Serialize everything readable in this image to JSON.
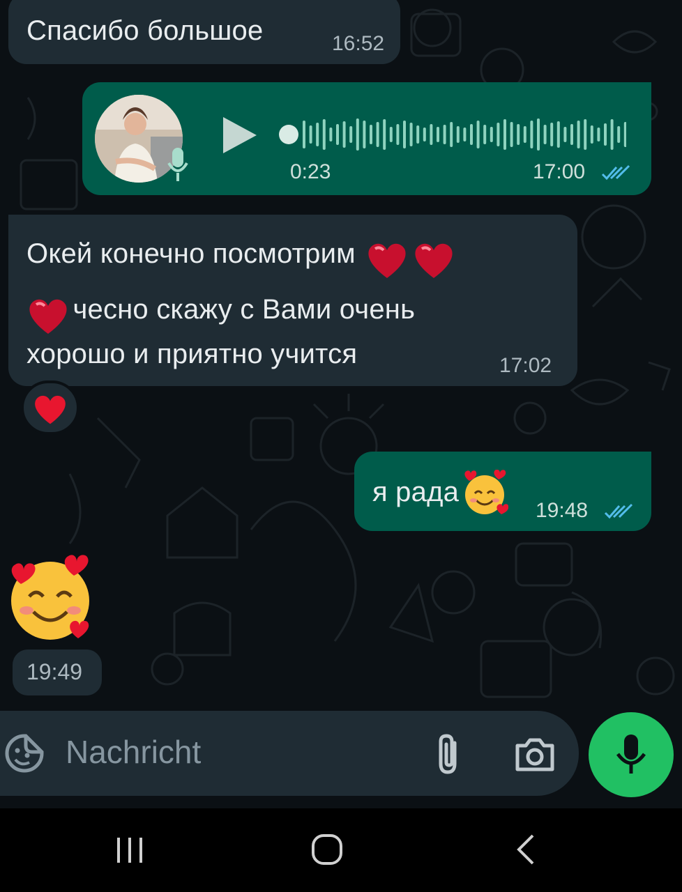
{
  "messages": [
    {
      "type": "incoming-text",
      "text": "Спасибо большое",
      "time": "16:52"
    },
    {
      "type": "outgoing-voice",
      "duration": "0:23",
      "time": "17:00",
      "status": "read",
      "progress": 0
    },
    {
      "type": "incoming-text",
      "line1": "Окей конечно посмотрим",
      "line2": "чесно скажу с Вами очень",
      "line3": "хорошо и приятно учится",
      "time": "17:02",
      "reaction": "heart"
    },
    {
      "type": "outgoing-text",
      "text": "я рада",
      "time": "19:48",
      "status": "read"
    },
    {
      "type": "incoming-emoji",
      "emoji": "smiling-face-with-hearts",
      "time": "19:49"
    }
  ],
  "composer": {
    "placeholder": "Nachricht",
    "icons": [
      "emoji-sticker-icon",
      "attach-icon",
      "camera-icon",
      "mic-icon"
    ]
  },
  "colors": {
    "background": "#0b1014",
    "incoming_bubble": "#1f2c34",
    "outgoing_bubble": "#005c4b",
    "read_ticks": "#53bdeb",
    "mic_button": "#21c063"
  },
  "nav": [
    "recents-icon",
    "home-icon",
    "back-icon"
  ]
}
